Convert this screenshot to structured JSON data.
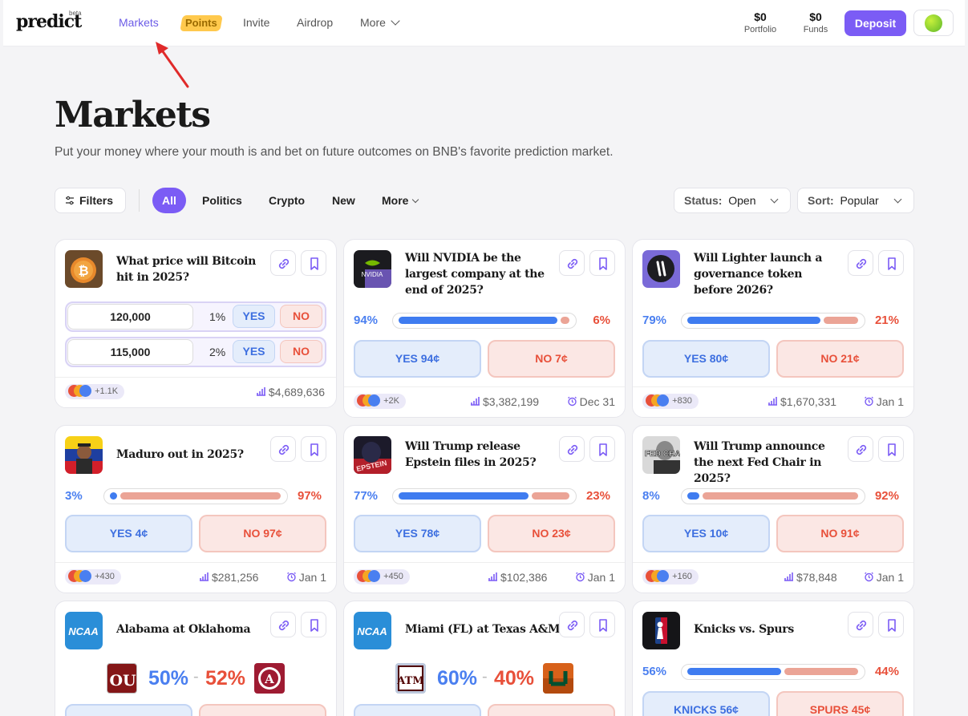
{
  "nav": {
    "logo": "predict",
    "beta": "beta",
    "links": [
      "Markets",
      "Points",
      "Invite",
      "Airdrop",
      "More"
    ],
    "portfolio_value": "$0",
    "portfolio_label": "Portfolio",
    "funds_value": "$0",
    "funds_label": "Funds",
    "deposit_label": "Deposit"
  },
  "header": {
    "title": "Markets",
    "subtitle": "Put your money where your mouth is and bet on future outcomes on BNB's favorite prediction market."
  },
  "filters": {
    "filters_label": "Filters",
    "tabs": [
      "All",
      "Politics",
      "Crypto",
      "New",
      "More"
    ],
    "status_key": "Status:",
    "status_value": "Open",
    "sort_key": "Sort:",
    "sort_value": "Popular"
  },
  "colors": {
    "accent": "#7b5cf5",
    "yes": "#4a7ff0",
    "no": "#e8503a"
  },
  "markets": [
    {
      "title": "What price will Bitcoin hit in 2025?",
      "outcomes": [
        {
          "value": "120,000",
          "pct": "1%",
          "yes": "YES",
          "no": "NO"
        },
        {
          "value": "115,000",
          "pct": "2%",
          "yes": "YES",
          "no": "NO"
        }
      ],
      "traders": "+1.1K",
      "volume": "$4,689,636"
    },
    {
      "title": "Will NVIDIA be the largest company at the end of 2025?",
      "yes_pct": "94%",
      "no_pct": "6%",
      "yes_fraction": 0.94,
      "yes_label": "YES 94¢",
      "no_label": "NO 7¢",
      "traders": "+2K",
      "volume": "$3,382,199",
      "date": "Dec 31"
    },
    {
      "title": "Will Lighter launch a governance token before 2026?",
      "yes_pct": "79%",
      "no_pct": "21%",
      "yes_fraction": 0.79,
      "yes_label": "YES 80¢",
      "no_label": "NO 21¢",
      "traders": "+830",
      "volume": "$1,670,331",
      "date": "Jan 1"
    },
    {
      "title": "Maduro out in 2025?",
      "yes_pct": "3%",
      "no_pct": "97%",
      "yes_fraction": 0.03,
      "yes_label": "YES 4¢",
      "no_label": "NO 97¢",
      "traders": "+430",
      "volume": "$281,256",
      "date": "Jan 1"
    },
    {
      "title": "Will Trump release Epstein files in 2025?",
      "thumb_text": "EPSTEIN",
      "yes_pct": "77%",
      "no_pct": "23%",
      "yes_fraction": 0.77,
      "yes_label": "YES 78¢",
      "no_label": "NO 23¢",
      "traders": "+450",
      "volume": "$102,386",
      "date": "Jan 1"
    },
    {
      "title": "Will Trump announce the next Fed Chair in 2025?",
      "thumb_text": "FED CHAIR",
      "yes_pct": "8%",
      "no_pct": "92%",
      "yes_fraction": 0.08,
      "yes_label": "YES 10¢",
      "no_label": "NO 91¢",
      "traders": "+160",
      "volume": "$78,848",
      "date": "Jan 1"
    },
    {
      "title": "Alabama at Oklahoma",
      "thumb_text": "NCAA",
      "left_pct": "50%",
      "right_pct": "52%"
    },
    {
      "title": "Miami (FL) at Texas A&M",
      "thumb_text": "NCAA",
      "left_pct": "60%",
      "right_pct": "40%"
    },
    {
      "title": "Knicks vs. Spurs",
      "yes_pct": "56%",
      "no_pct": "44%",
      "yes_fraction": 0.56,
      "yes_label": "KNICKS 56¢",
      "no_label": "SPURS 45¢"
    }
  ]
}
